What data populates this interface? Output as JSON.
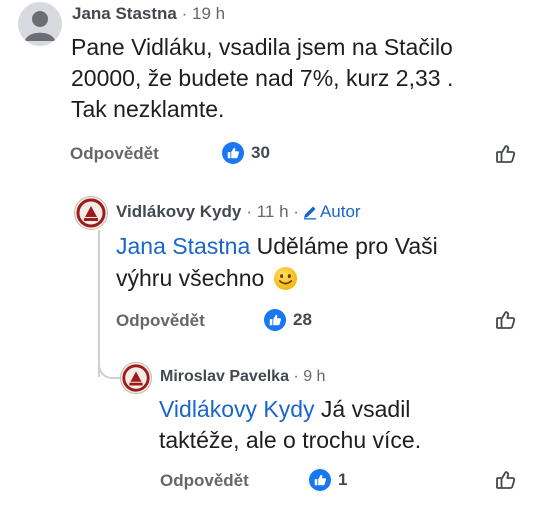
{
  "comments": [
    {
      "author": "Jana Stastna",
      "time": "· 19 h",
      "text_lines": [
        "Pane Vidláku, vsadila jsem na Stačilo",
        "20000, že budete nad 7%, kurz 2,33 .",
        "Tak nezklamte."
      ],
      "reply_label": "Odpovědět",
      "likes": "30"
    },
    {
      "author": "Vidlákovy Kydy",
      "time": "· 11 h ·",
      "author_badge": "Autor",
      "mention": "Jana Stastna",
      "text_first": " Uděláme pro Vaši",
      "text_second": "výhru všechno",
      "emoji": "smiling-face",
      "reply_label": "Odpovědět",
      "likes": "28"
    },
    {
      "author": "Miroslav Pavelka",
      "time": "· 9 h",
      "mention": "Vidlákovy Kydy",
      "text_first": " Já vsadil",
      "text_second": "taktéže, ale o trochu více.",
      "reply_label": "Odpovědět",
      "likes": "1"
    }
  ],
  "colors": {
    "like_blue": "#1877f2",
    "mention_blue": "#1a66c6",
    "meta_gray": "#65676b"
  },
  "icons": [
    "default-avatar-icon",
    "page-avatar-icon",
    "like-badge-icon",
    "thumbs-up-outline-icon",
    "pencil-icon",
    "smiley-emoji-icon"
  ]
}
